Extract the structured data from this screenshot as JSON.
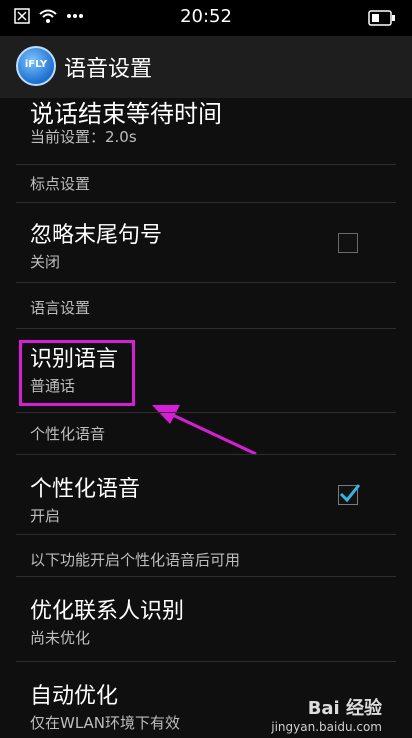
{
  "status_bar": {
    "time": "20:52"
  },
  "app_bar": {
    "title": "语音设置",
    "logo_text": "iFLY"
  },
  "items": [
    {
      "title": "说话结束等待时间",
      "summary": "当前设置：2.0s"
    },
    {
      "section": "标点设置"
    },
    {
      "title": "忽略末尾句号",
      "summary": "关闭",
      "checked": false
    },
    {
      "section": "语言设置"
    },
    {
      "title": "识别语言",
      "summary": "普通话"
    },
    {
      "section": "个性化语音"
    },
    {
      "title": "个性化语音",
      "summary": "开启",
      "checked": true
    },
    {
      "section": "以下功能开启个性化语音后可用"
    },
    {
      "title": "优化联系人识别",
      "summary": "尚未优化"
    },
    {
      "title": "自动优化",
      "summary": "仅在WLAN环境下有效"
    }
  ],
  "colors": {
    "highlight": "#d61ed6",
    "check": "#33b5e5"
  },
  "watermark": {
    "brand": "Bai 经验",
    "url": "jingyan.baidu.com"
  }
}
